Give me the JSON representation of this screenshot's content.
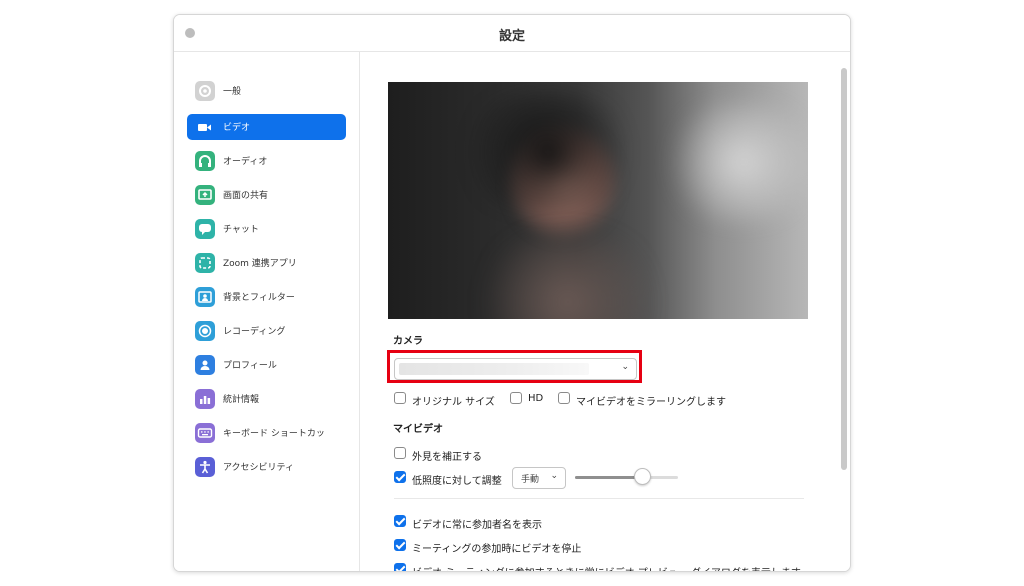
{
  "window": {
    "title": "設定"
  },
  "sidebar": {
    "items": [
      {
        "label": "一般",
        "icon": "gear-icon",
        "color": "#c8c8c8"
      },
      {
        "label": "ビデオ",
        "icon": "video-camera-icon",
        "color": "#0e71eb",
        "active": true
      },
      {
        "label": "オーディオ",
        "icon": "headphones-icon",
        "color": "#34b27d"
      },
      {
        "label": "画面の共有",
        "icon": "share-screen-icon",
        "color": "#34b27d"
      },
      {
        "label": "チャット",
        "icon": "chat-bubble-icon",
        "color": "#2eb3a8"
      },
      {
        "label": "Zoom 連携アプリ",
        "icon": "apps-icon",
        "color": "#2eb3a8"
      },
      {
        "label": "背景とフィルター",
        "icon": "portrait-icon",
        "color": "#2e9fd8"
      },
      {
        "label": "レコーディング",
        "icon": "record-icon",
        "color": "#2e9fd8"
      },
      {
        "label": "プロフィール",
        "icon": "person-icon",
        "color": "#2e7fe0"
      },
      {
        "label": "統計情報",
        "icon": "bar-chart-icon",
        "color": "#8a6fd6"
      },
      {
        "label": "キーボード ショートカッ",
        "icon": "keyboard-icon",
        "color": "#8a6fd6"
      },
      {
        "label": "アクセシビリティ",
        "icon": "accessibility-icon",
        "color": "#5a5fd6"
      }
    ]
  },
  "camera": {
    "section_label": "カメラ",
    "selected_value": ""
  },
  "camera_options": [
    {
      "label": "オリジナル サイズ",
      "checked": false
    },
    {
      "label": "HD",
      "checked": false
    },
    {
      "label": "マイビデオをミラーリングします",
      "checked": false
    }
  ],
  "my_video": {
    "section_label": "マイビデオ",
    "touch_up": {
      "label": "外見を補正する",
      "checked": false
    },
    "low_light": {
      "label": "低照度に対して調整",
      "checked": true,
      "mode": "手動",
      "level": 0.65
    }
  },
  "meeting_options": [
    {
      "label": "ビデオに常に参加者名を表示",
      "checked": true
    },
    {
      "label": "ミーティングの参加時にビデオを停止",
      "checked": true
    },
    {
      "label": "ビデオ ミーティングに参加するときに常にビデオ プレビュー ダイアログを表示します",
      "checked": true
    }
  ],
  "colors": {
    "accent": "#0e71eb",
    "highlight": "#e60012"
  }
}
